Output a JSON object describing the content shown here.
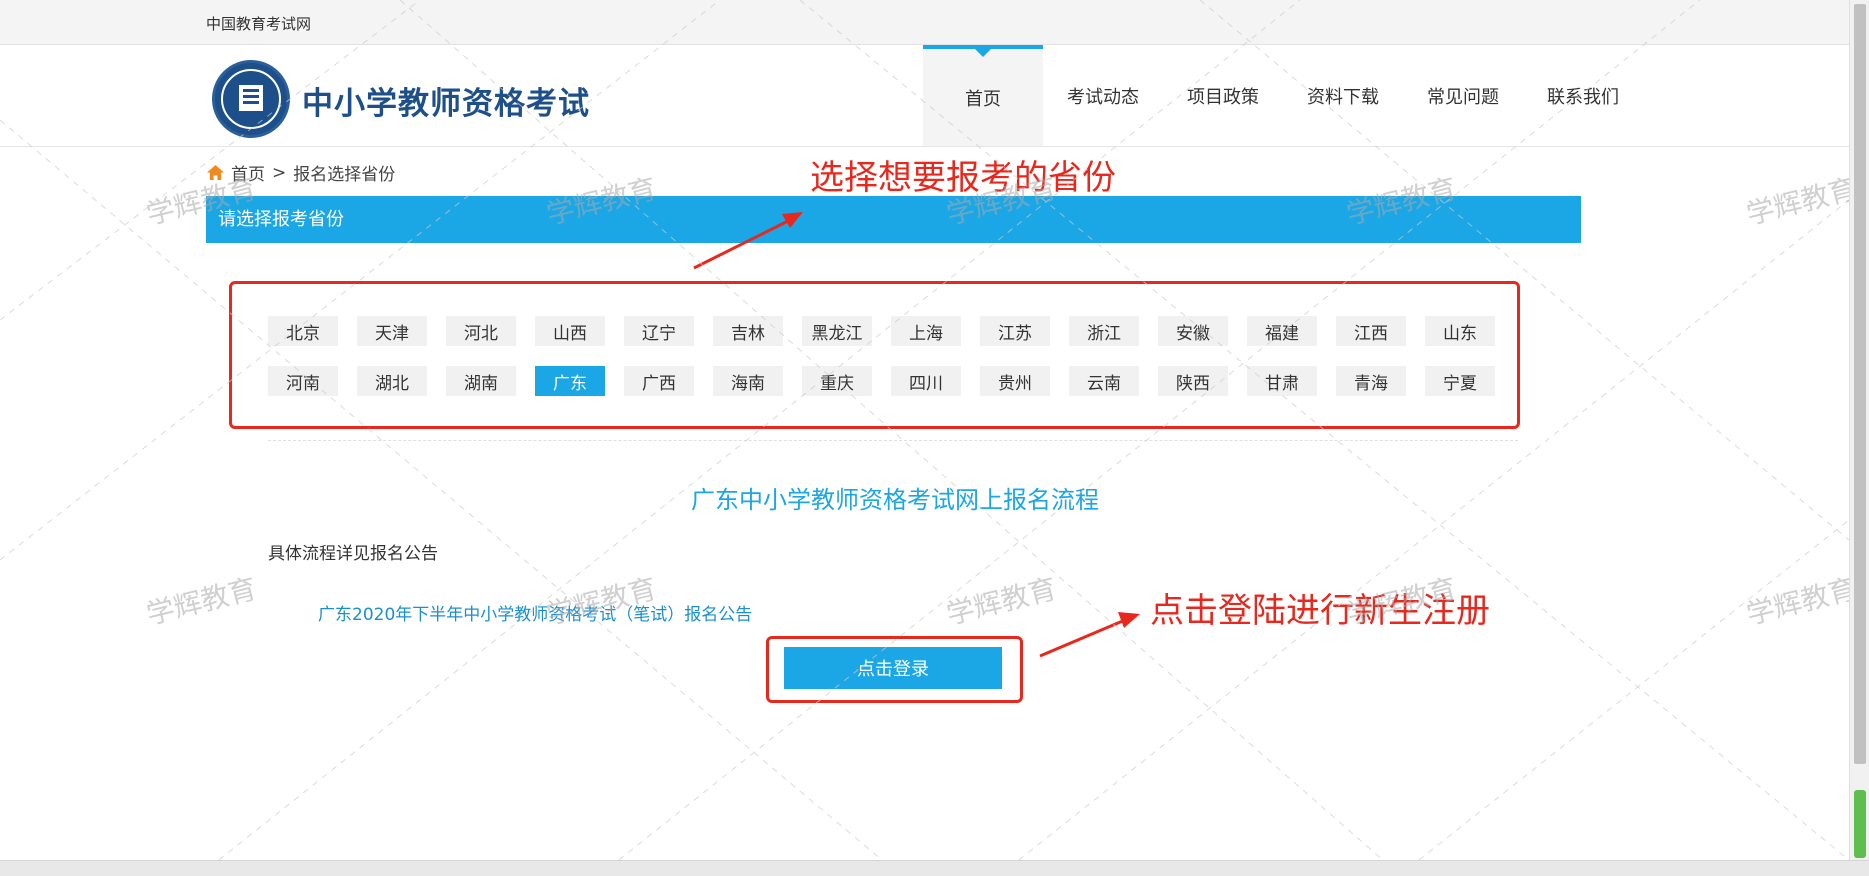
{
  "topbar": {
    "site_name": "中国教育考试网"
  },
  "header": {
    "logo_title": "中小学教师资格考试",
    "nav": [
      "首页",
      "考试动态",
      "项目政策",
      "资料下载",
      "常见问题",
      "联系我们"
    ],
    "active_nav": "首页"
  },
  "breadcrumb": {
    "home": "首页",
    "separator": ">",
    "current": "报名选择省份"
  },
  "section": {
    "title": "请选择报考省份"
  },
  "provinces": {
    "row1": [
      "北京",
      "天津",
      "河北",
      "山西",
      "辽宁",
      "吉林",
      "黑龙江",
      "上海",
      "江苏",
      "浙江",
      "安徽",
      "福建",
      "江西",
      "山东"
    ],
    "row2": [
      "河南",
      "湖北",
      "湖南",
      "广东",
      "广西",
      "海南",
      "重庆",
      "四川",
      "贵州",
      "云南",
      "陕西",
      "甘肃",
      "青海",
      "宁夏"
    ],
    "selected": "广东"
  },
  "flow": {
    "title": "广东中小学教师资格考试网上报名流程",
    "detail": "具体流程详见报名公告",
    "notice_link": "广东2020年下半年中小学教师资格考试（笔试）报名公告"
  },
  "login_button": "点击登录",
  "annotations": {
    "select_province": "选择想要报考的省份",
    "click_login": "点击登陆进行新生注册"
  },
  "watermark": "学辉教育",
  "colors": {
    "accent": "#1ba6e6",
    "annotation": "#e8271d",
    "logo": "#1d4f8a"
  }
}
